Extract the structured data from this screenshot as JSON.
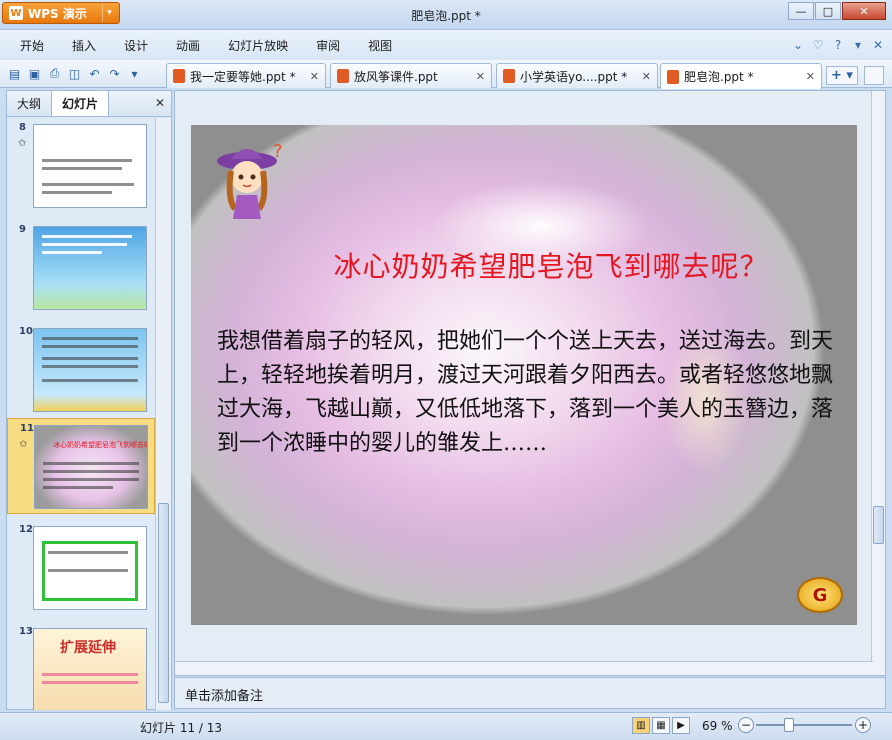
{
  "app": {
    "name": "WPS 演示",
    "window_title": "肥皂泡.ppt *"
  },
  "window_controls": {
    "minimize": "—",
    "maximize": "□",
    "close": "✕"
  },
  "menu": {
    "items": [
      "开始",
      "插入",
      "设计",
      "动画",
      "幻灯片放映",
      "审阅",
      "视图"
    ]
  },
  "tabs": [
    {
      "label": "我一定要等她.ppt *",
      "active": false
    },
    {
      "label": "放风筝课件.ppt",
      "active": false
    },
    {
      "label": "小学英语yo....ppt *",
      "active": false
    },
    {
      "label": "肥皂泡.ppt *",
      "active": true
    }
  ],
  "left_panel": {
    "tabs": [
      "大纲",
      "幻灯片"
    ],
    "active_tab": "幻灯片",
    "thumbnails": [
      {
        "num": "8",
        "star": "✩"
      },
      {
        "num": "9"
      },
      {
        "num": "10"
      },
      {
        "num": "11",
        "star": "✩",
        "selected": true,
        "caption": "冰心奶奶希望肥皂泡飞到哪去呢？"
      },
      {
        "num": "12"
      },
      {
        "num": "13",
        "caption": "扩展延伸"
      }
    ]
  },
  "slide": {
    "title": "冰心奶奶希望肥皂泡飞到哪去呢？",
    "body": "我想借着扇子的轻风，把她们一个个送上天去，送过海去。到天上，轻轻地挨着明月，渡过天河跟着夕阳西去。或者轻悠悠地飘过大海，飞越山巅，又低低地落下，落到一个美人的玉簪边，落到一个浓睡中的婴儿的雏发上……",
    "nav_button": "G",
    "colors": {
      "title": "#e4161f",
      "body": "#111111"
    }
  },
  "notes": {
    "placeholder": "单击添加备注"
  },
  "status": {
    "slide_count": "幻灯片 11 / 13",
    "zoom": "69 %"
  }
}
